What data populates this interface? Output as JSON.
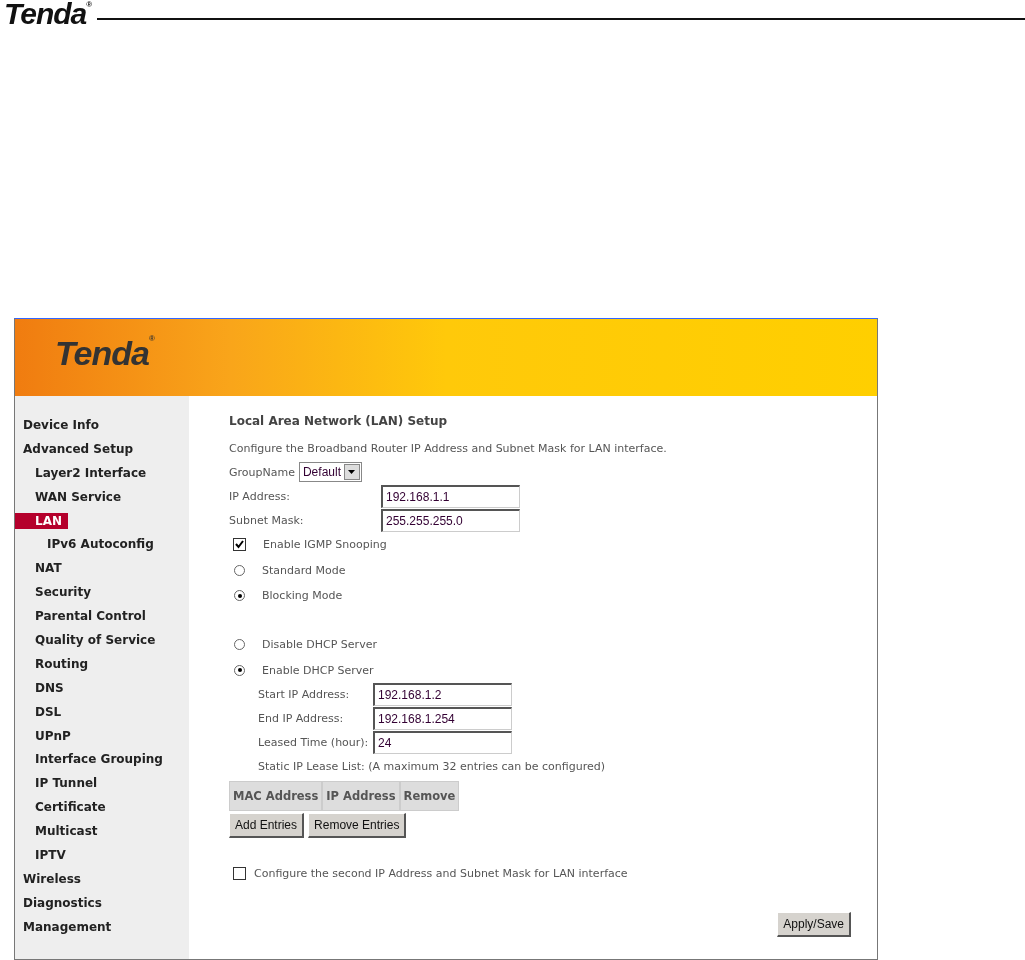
{
  "doc_header": {
    "logo": "Tenda",
    "registered": "®"
  },
  "banner": {
    "logo": "Tenda",
    "registered": "®"
  },
  "sidebar": {
    "items": [
      {
        "label": "Device Info",
        "selected": false
      },
      {
        "label": "Advanced Setup",
        "selected": false,
        "children": [
          {
            "label": "Layer2 Interface",
            "selected": false
          },
          {
            "label": "WAN Service",
            "selected": false
          },
          {
            "label": "LAN",
            "selected": true,
            "children": [
              {
                "label": "IPv6 Autoconfig",
                "selected": false
              }
            ]
          },
          {
            "label": "NAT",
            "selected": false
          },
          {
            "label": "Security",
            "selected": false
          },
          {
            "label": "Parental Control",
            "selected": false
          },
          {
            "label": "Quality of Service",
            "selected": false
          },
          {
            "label": "Routing",
            "selected": false
          },
          {
            "label": "DNS",
            "selected": false
          },
          {
            "label": "DSL",
            "selected": false
          },
          {
            "label": "UPnP",
            "selected": false
          },
          {
            "label": "Interface Grouping",
            "selected": false
          },
          {
            "label": "IP Tunnel",
            "selected": false
          },
          {
            "label": "Certificate",
            "selected": false
          },
          {
            "label": "Multicast",
            "selected": false
          },
          {
            "label": "IPTV",
            "selected": false
          }
        ]
      },
      {
        "label": "Wireless",
        "selected": false
      },
      {
        "label": "Diagnostics",
        "selected": false
      },
      {
        "label": "Management",
        "selected": false
      }
    ]
  },
  "form": {
    "title": "Local Area Network (LAN) Setup",
    "description": "Configure the Broadband Router IP Address and Subnet Mask for LAN interface.",
    "group_name": {
      "label": "GroupName",
      "value": "Default"
    },
    "ip_address": {
      "label": "IP Address:",
      "value": "192.168.1.1"
    },
    "subnet_mask": {
      "label": "Subnet Mask:",
      "value": "255.255.255.0"
    },
    "igmp_snooping": {
      "label": "Enable IGMP Snooping",
      "checked": true
    },
    "igmp_modes": [
      {
        "label": "Standard Mode",
        "selected": false
      },
      {
        "label": "Blocking Mode",
        "selected": true
      }
    ],
    "dhcp_modes": [
      {
        "label": "Disable DHCP Server",
        "selected": false
      },
      {
        "label": "Enable DHCP Server",
        "selected": true
      }
    ],
    "dhcp_fields": [
      {
        "label": "Start IP Address:",
        "value": "192.168.1.2"
      },
      {
        "label": "End IP Address:",
        "value": "192.168.1.254"
      },
      {
        "label": "Leased Time (hour):",
        "value": "24"
      }
    ],
    "static_lease": {
      "caption": "Static IP Lease List: (A maximum 32 entries can be configured)",
      "columns": [
        "MAC Address",
        "IP Address",
        "Remove"
      ]
    },
    "lease_buttons": [
      "Add Entries",
      "Remove Entries"
    ],
    "second_ip": {
      "label": "Configure the second IP Address and Subnet Mask for LAN interface",
      "checked": false
    },
    "apply_button": "Apply/Save"
  }
}
